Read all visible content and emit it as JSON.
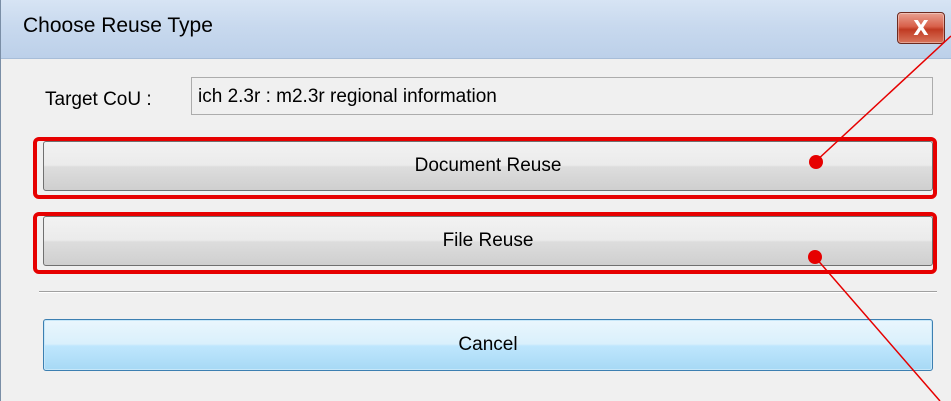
{
  "dialog": {
    "title": "Choose Reuse Type",
    "close_glyph": "X"
  },
  "target": {
    "label": "Target CoU :",
    "value": "ich 2.3r : m2.3r regional information"
  },
  "buttons": {
    "document_reuse": "Document Reuse",
    "file_reuse": "File Reuse",
    "cancel": "Cancel"
  },
  "annotations": {
    "highlight_color": "#e60000"
  }
}
